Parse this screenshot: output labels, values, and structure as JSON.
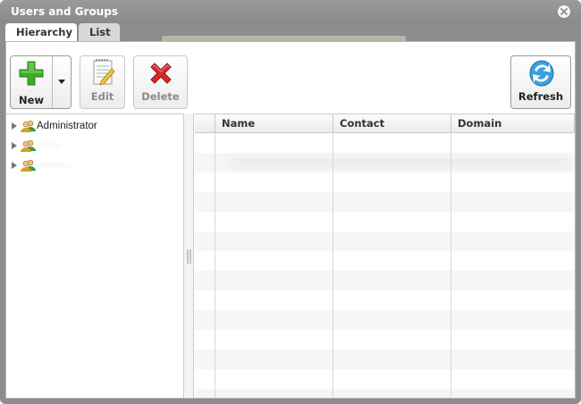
{
  "window": {
    "title": "Users and Groups"
  },
  "tabs": [
    {
      "label": "Hierarchy",
      "active": true
    },
    {
      "label": "List",
      "active": false
    }
  ],
  "toolbar": {
    "new_label": "New",
    "edit_label": "Edit",
    "delete_label": "Delete",
    "refresh_label": "Refresh"
  },
  "tree": {
    "items": [
      {
        "label": "Administrator",
        "blurred": false
      },
      {
        "label": "·······",
        "blurred": true
      },
      {
        "label": "··········",
        "blurred": true
      }
    ]
  },
  "grid": {
    "columns": [
      {
        "label": "Name"
      },
      {
        "label": "Contact"
      },
      {
        "label": "Domain"
      }
    ]
  },
  "colors": {
    "title_bar": "#8d8d8d",
    "accent_green": "#3faa2c",
    "accent_red": "#d62a2a",
    "accent_blue": "#2a8fd6"
  }
}
